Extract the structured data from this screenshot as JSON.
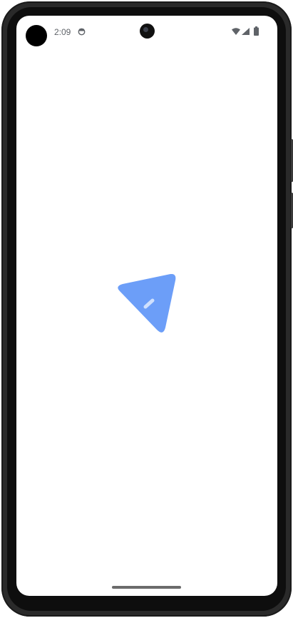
{
  "status_bar": {
    "time": "2:09",
    "icons": [
      "avatar-dot",
      "app-notification-icon",
      "front-camera",
      "wifi-icon",
      "signal-icon",
      "battery-icon"
    ]
  },
  "splash": {
    "logo_icon": "paper-plane-send-icon",
    "logo_color": "#6c9ef8",
    "logo_highlight_color": "#cfe0fd"
  },
  "navigation": {
    "gesture_bar": "home-indicator"
  },
  "colors": {
    "screen_background": "#ffffff",
    "status_text": "#5f6368",
    "device_frame": "#2a2a2a"
  }
}
